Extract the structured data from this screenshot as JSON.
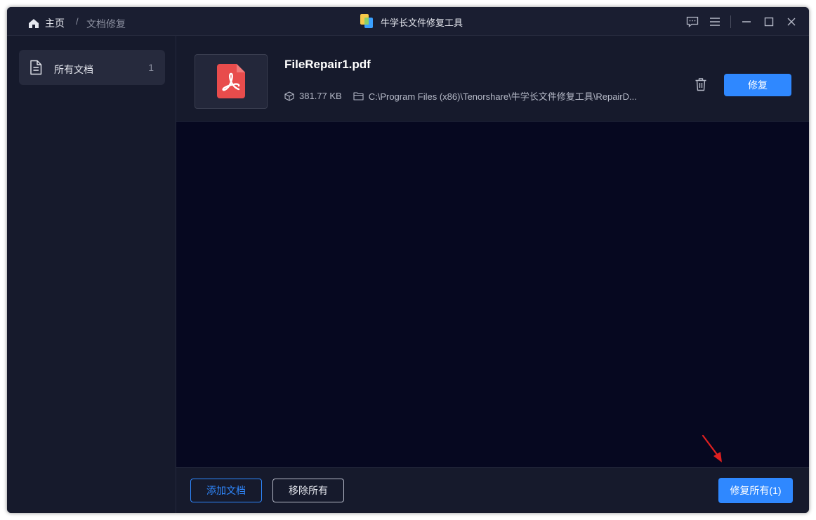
{
  "titlebar": {
    "home_label": "主页",
    "separator": "/",
    "current_page": "文档修复",
    "app_title": "牛学长文件修复工具"
  },
  "sidebar": {
    "items": [
      {
        "label": "所有文档",
        "count": "1",
        "icon": "document-icon"
      }
    ]
  },
  "files": [
    {
      "name": "FileRepair1.pdf",
      "size": "381.77 KB",
      "path": "C:\\Program Files (x86)\\Tenorshare\\牛学长文件修复工具\\RepairD...",
      "repair_label": "修复",
      "icon": "pdf-file-icon"
    }
  ],
  "footer": {
    "add_label": "添加文档",
    "remove_all_label": "移除所有",
    "repair_all_label": "修复所有(1)"
  },
  "colors": {
    "accent": "#2f88ff",
    "background": "#161a2c",
    "content_background": "#060820",
    "pdf_red": "#e84c4c",
    "annotation_arrow": "#e02020"
  }
}
